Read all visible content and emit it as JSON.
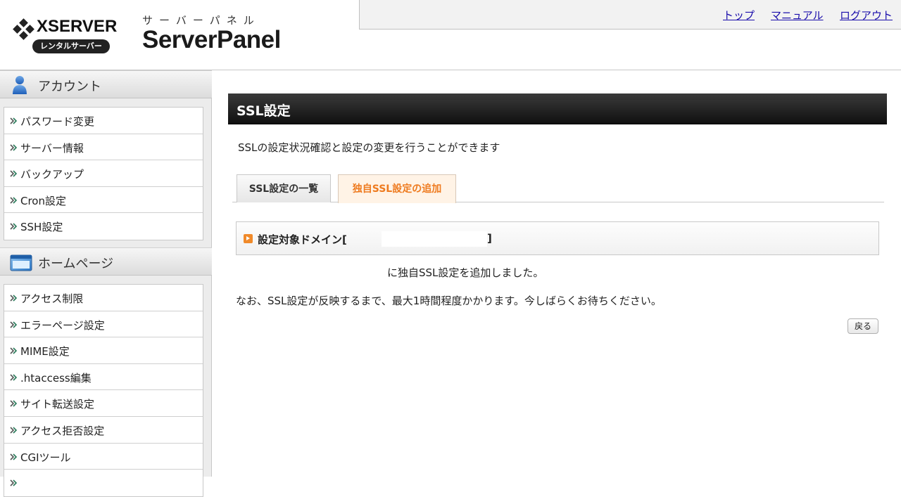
{
  "header": {
    "logo_text": "XSERVER",
    "logo_badge": "レンタルサーバー",
    "panel_kana": "サーバーパネル",
    "panel_name": "ServerPanel",
    "nav": [
      {
        "label": "トップ"
      },
      {
        "label": "マニュアル"
      },
      {
        "label": "ログアウト"
      }
    ]
  },
  "sidebar": {
    "sections": [
      {
        "title": "アカウント",
        "icon": "person-icon",
        "items": [
          {
            "label": "パスワード変更"
          },
          {
            "label": "サーバー情報"
          },
          {
            "label": "バックアップ"
          },
          {
            "label": "Cron設定"
          },
          {
            "label": "SSH設定"
          }
        ]
      },
      {
        "title": "ホームページ",
        "icon": "window-icon",
        "items": [
          {
            "label": "アクセス制限"
          },
          {
            "label": "エラーページ設定"
          },
          {
            "label": "MIME設定"
          },
          {
            "label": ".htaccess編集"
          },
          {
            "label": "サイト転送設定"
          },
          {
            "label": "アクセス拒否設定"
          },
          {
            "label": "CGIツール"
          },
          {
            "label": ""
          }
        ]
      }
    ]
  },
  "main": {
    "title": "SSL設定",
    "description": "SSLの設定状況確認と設定の変更を行うことができます",
    "tabs": [
      {
        "label": "SSL設定の一覧",
        "active": false
      },
      {
        "label": "独自SSL設定の追加",
        "active": true
      }
    ],
    "domain_label": "設定対象ドメイン[",
    "domain_value": "",
    "domain_close": "]",
    "message_added": "に独自SSL設定を追加しました。",
    "message_notice": "なお、SSL設定が反映するまで、最大1時間程度かかります。今しばらくお待ちください。",
    "back_button": "戻る"
  },
  "colors": {
    "accent_orange": "#ee7a1e",
    "link": "#1a0dab",
    "title_bar": "#1a1a1a"
  }
}
